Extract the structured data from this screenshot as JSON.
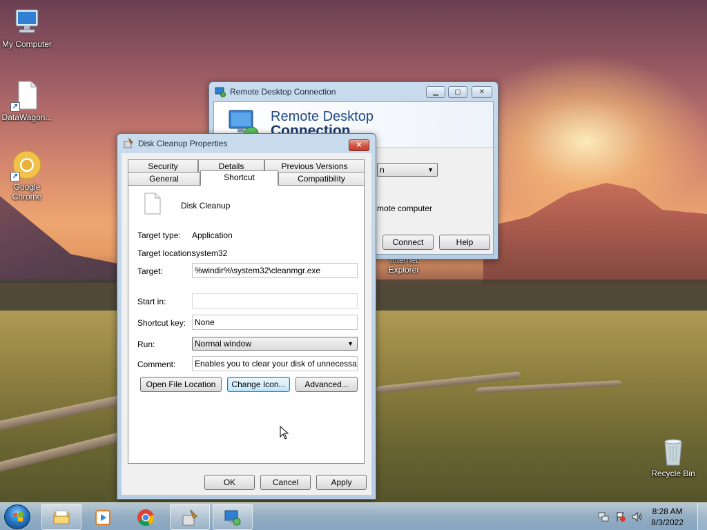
{
  "desktop": {
    "icons": [
      {
        "label": "My Computer",
        "icon": "computer-icon"
      },
      {
        "label": "DataWagon...",
        "icon": "file-shortcut-icon"
      },
      {
        "label": "Google Chrome",
        "icon": "chrome-icon"
      },
      {
        "label": "Internet Explorer",
        "icon": "ie-icon"
      },
      {
        "label": "Recycle Bin",
        "icon": "recycle-bin-icon"
      }
    ]
  },
  "rdc_window": {
    "title": "Remote Desktop Connection",
    "banner_line1": "Remote Desktop",
    "banner_line2": "Connection",
    "combo_fragment": "n",
    "text_fragment": "mote computer",
    "connect_label": "Connect",
    "help_label": "Help",
    "min_glyph": "▁",
    "max_glyph": "▢",
    "close_glyph": "✕"
  },
  "props_window": {
    "title": "Disk Cleanup Properties",
    "close_glyph": "✕",
    "tabs_back": [
      "Security",
      "Details",
      "Previous Versions"
    ],
    "tabs_front": [
      "General",
      "Shortcut",
      "Compatibility"
    ],
    "active_tab": "Shortcut",
    "app_name": "Disk Cleanup",
    "target_type_label": "Target type:",
    "target_type_value": "Application",
    "target_location_label": "Target location:",
    "target_location_value": "system32",
    "target_label": "Target:",
    "target_value": "%windir%\\system32\\cleanmgr.exe",
    "start_in_label": "Start in:",
    "start_in_value": "",
    "shortcut_key_label": "Shortcut key:",
    "shortcut_key_value": "None",
    "run_label": "Run:",
    "run_value": "Normal window",
    "comment_label": "Comment:",
    "comment_value": "Enables you to clear your disk of unnecessary files",
    "open_file_location_label": "Open File Location",
    "change_icon_label": "Change Icon...",
    "advanced_label": "Advanced...",
    "ok_label": "OK",
    "cancel_label": "Cancel",
    "apply_label": "Apply"
  },
  "taskbar": {
    "time": "8:28 AM",
    "date": "8/3/2022",
    "apps": [
      "windows-explorer-icon",
      "media-player-icon",
      "chrome-icon",
      "cleanmgr-icon",
      "remote-desktop-icon"
    ]
  }
}
